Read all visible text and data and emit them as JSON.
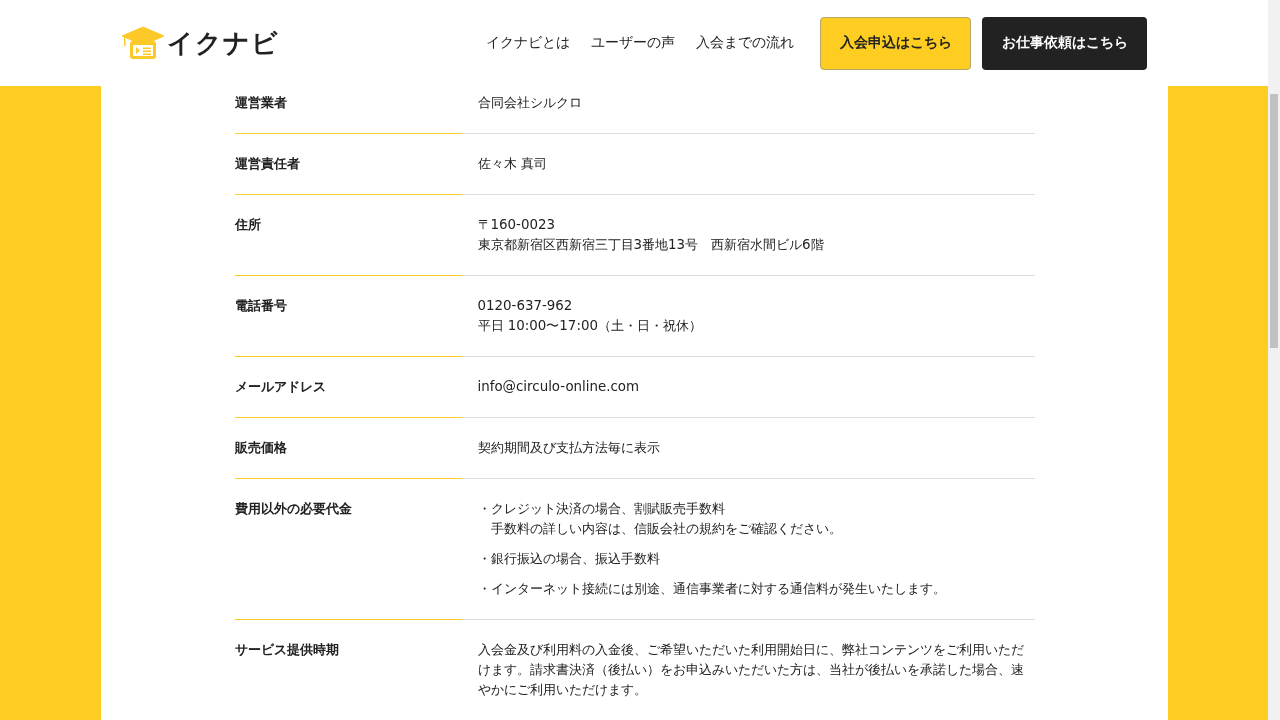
{
  "header": {
    "logo": "イクナビ",
    "nav": [
      "イクナビとは",
      "ユーザーの声",
      "入会までの流れ"
    ],
    "buttons": [
      {
        "label": "入会申込はこちら",
        "kind": "primary"
      },
      {
        "label": "お仕事依頼はこちら",
        "kind": "dark"
      }
    ]
  },
  "table": {
    "rows": [
      {
        "label": "運営業者",
        "kind": "lines",
        "lines": [
          "合同会社シルクロ"
        ]
      },
      {
        "label": "運営責任者",
        "kind": "lines",
        "lines": [
          "佐々木 真司"
        ]
      },
      {
        "label": "住所",
        "kind": "lines",
        "lines": [
          "〒160-0023",
          "東京都新宿区西新宿三丁目3番地13号　西新宿水間ビル6階"
        ]
      },
      {
        "label": "電話番号",
        "kind": "lines",
        "lines": [
          "0120-637-962",
          "平日 10:00〜17:00（土・日・祝休）"
        ]
      },
      {
        "label": "メールアドレス",
        "kind": "lines",
        "lines": [
          "info@circulo-online.com"
        ]
      },
      {
        "label": "販売価格",
        "kind": "lines",
        "lines": [
          "契約期間及び支払方法毎に表示"
        ]
      },
      {
        "label": "費用以外の必要代金",
        "kind": "bullets",
        "items": [
          {
            "bullet": "・",
            "lines": [
              "クレジット決済の場合、割賦販売手数料",
              "手数料の詳しい内容は、信販会社の規約をご確認ください。"
            ]
          },
          {
            "bullet": "・",
            "lines": [
              "銀行振込の場合、振込手数料"
            ]
          },
          {
            "bullet": "・",
            "lines": [
              "インターネット接続には別途、通信事業者に対する通信料が発生いたします。"
            ]
          }
        ]
      },
      {
        "label": "サービス提供時期",
        "kind": "paragraph",
        "text": "入会金及び利用料の入金後、ご希望いただいた利用開始日に、弊社コンテンツをご利用いただけます。請求書決済（後払い）をお申込みいただいた方は、当社が後払いを承諾した場合、速やかにご利用いただけます。"
      }
    ]
  }
}
